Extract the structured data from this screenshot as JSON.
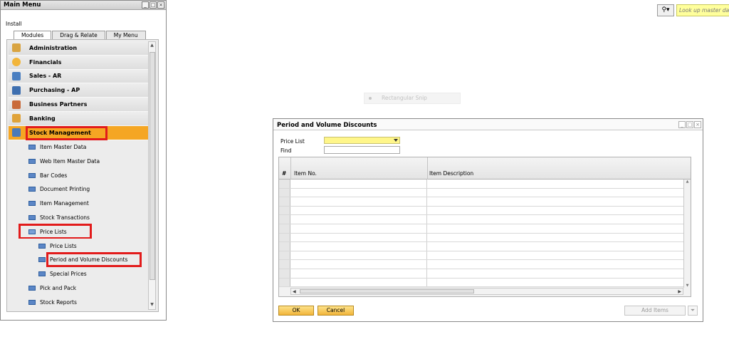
{
  "main_menu": {
    "title": "Main Menu",
    "install_label": "Install",
    "tabs": [
      {
        "label": "Modules"
      },
      {
        "label": "Drag & Relate"
      },
      {
        "label": "My Menu"
      }
    ],
    "modules": [
      {
        "label": "Administration",
        "icon": "administration-icon",
        "color": "#d9a441"
      },
      {
        "label": "Financials",
        "icon": "financials-icon",
        "color": "#f2b53a"
      },
      {
        "label": "Sales - AR",
        "icon": "sales-icon",
        "color": "#4a7fc1"
      },
      {
        "label": "Purchasing - AP",
        "icon": "purchasing-cart-icon",
        "color": "#3e6fb0"
      },
      {
        "label": "Business Partners",
        "icon": "business-partners-icon",
        "color": "#c96a3a"
      },
      {
        "label": "Banking",
        "icon": "banking-icon",
        "color": "#e0a33a"
      },
      {
        "label": "Stock Management",
        "icon": "stock-management-icon",
        "color": "#4c7ab7"
      }
    ],
    "stock_items": [
      {
        "label": "Item Master Data"
      },
      {
        "label": "Web Item Master Data"
      },
      {
        "label": "Bar Codes"
      },
      {
        "label": "Document Printing"
      },
      {
        "label": "Item Management"
      },
      {
        "label": "Stock Transactions"
      },
      {
        "label": "Price Lists"
      }
    ],
    "price_list_items": [
      {
        "label": "Price Lists"
      },
      {
        "label": "Period and Volume Discounts"
      },
      {
        "label": "Special Prices"
      }
    ],
    "after_items": [
      {
        "label": "Pick and Pack"
      },
      {
        "label": "Stock Reports"
      }
    ]
  },
  "lookup": {
    "placeholder": "Look up master da"
  },
  "snip": {
    "label": "Rectangular Snip"
  },
  "pvd": {
    "title": "Period and Volume Discounts",
    "price_list_label": "Price List",
    "find_label": "Find",
    "price_list_value": "",
    "find_value": "",
    "columns": [
      "#",
      "Item No.",
      "Item Description"
    ],
    "rows": [
      {},
      {},
      {},
      {},
      {},
      {},
      {},
      {},
      {},
      {},
      {},
      {}
    ],
    "ok_label": "OK",
    "cancel_label": "Cancel",
    "add_items_label": "Add Items"
  },
  "colors": {
    "selected_module": "#f5a623",
    "highlight": "#e21b1b",
    "sap_button": "#f2b43a",
    "mandatory_field": "#fff68a"
  }
}
